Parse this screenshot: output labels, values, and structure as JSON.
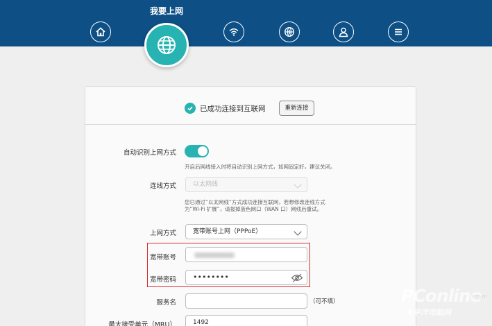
{
  "nav": {
    "active_title": "我要上网",
    "icons": [
      "home-icon",
      "globe-icon",
      "wifi-icon",
      "globe-settings-icon",
      "user-icon",
      "menu-icon"
    ]
  },
  "status": {
    "text": "已成功连接到互联网",
    "reconnect_label": "重新连接"
  },
  "form": {
    "auto_detect_label": "自动识别上网方式",
    "auto_detect_on": true,
    "auto_detect_hint": "开启后网线接入时将自动识别上网方式，如网固定好，建议关闭。",
    "connection_label": "连线方式",
    "connection_value": "以太网线",
    "connection_hint_1": "您已通过“以太网线”方式成功连接互联网，若想修改连线方式",
    "connection_hint_2": "为“Wi-Fi 扩展”，请拔掉蓝色网口（WAN 口）网线后重试。",
    "internet_label": "上网方式",
    "internet_value": "宽带账号上网（PPPoE）",
    "account_label": "宽带账号",
    "password_label": "宽带密码",
    "password_value": "••••••••",
    "service_label": "服务名",
    "service_value": "",
    "service_note": "（可不填）",
    "mru_label": "最大接受单元（MRU）",
    "mru_value": "1492"
  },
  "watermark": {
    "brand": "PConline",
    "site": ".com.cn",
    "sub": "太平洋电脑网"
  },
  "colors": {
    "header": "#0e4f86",
    "accent": "#26b3b1",
    "highlight_box": "#d92b2b"
  }
}
